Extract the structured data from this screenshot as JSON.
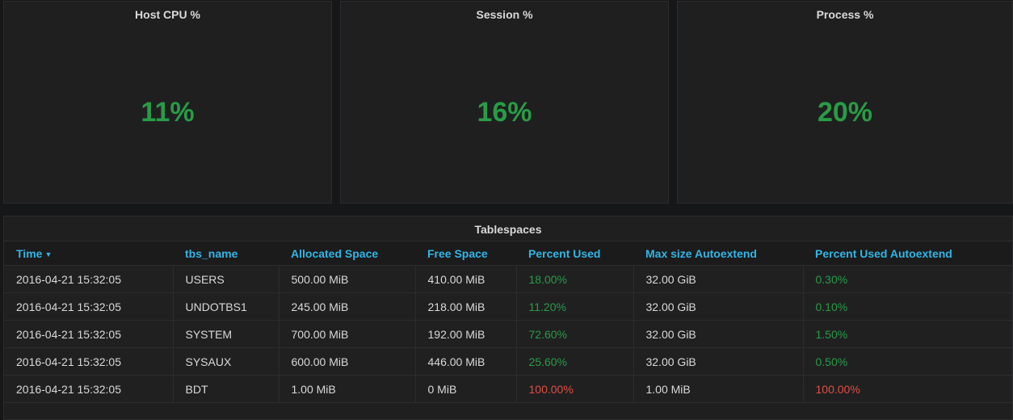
{
  "stats": [
    {
      "title": "Host CPU %",
      "value": "11%"
    },
    {
      "title": "Session %",
      "value": "16%"
    },
    {
      "title": "Process %",
      "value": "20%"
    }
  ],
  "table": {
    "title": "Tablespaces",
    "sort_indicator": "▼",
    "columns": [
      "Time",
      "tbs_name",
      "Allocated Space",
      "Free Space",
      "Percent Used",
      "Max size Autoextend",
      "Percent Used Autoextend"
    ],
    "rows": [
      [
        "2016-04-21 15:32:05",
        "USERS",
        "500.00 MiB",
        "410.00 MiB",
        "18.00%",
        "32.00 GiB",
        "0.30%"
      ],
      [
        "2016-04-21 15:32:05",
        "UNDOTBS1",
        "245.00 MiB",
        "218.00 MiB",
        "11.20%",
        "32.00 GiB",
        "0.10%"
      ],
      [
        "2016-04-21 15:32:05",
        "SYSTEM",
        "700.00 MiB",
        "192.00 MiB",
        "72.60%",
        "32.00 GiB",
        "1.50%"
      ],
      [
        "2016-04-21 15:32:05",
        "SYSAUX",
        "600.00 MiB",
        "446.00 MiB",
        "25.60%",
        "32.00 GiB",
        "0.50%"
      ],
      [
        "2016-04-21 15:32:05",
        "BDT",
        "1.00 MiB",
        "0 MiB",
        "100.00%",
        "1.00 MiB",
        "100.00%"
      ]
    ],
    "status": [
      [
        "ok",
        "ok"
      ],
      [
        "ok",
        "ok"
      ],
      [
        "ok",
        "ok"
      ],
      [
        "ok",
        "ok"
      ],
      [
        "critical",
        "critical"
      ]
    ]
  },
  "colors": {
    "background": "#161719",
    "panel": "#1f1f20",
    "stat_value": "#299c46",
    "header_text": "#33b5e5",
    "ok": "#299c46",
    "critical": "#e24d42"
  }
}
